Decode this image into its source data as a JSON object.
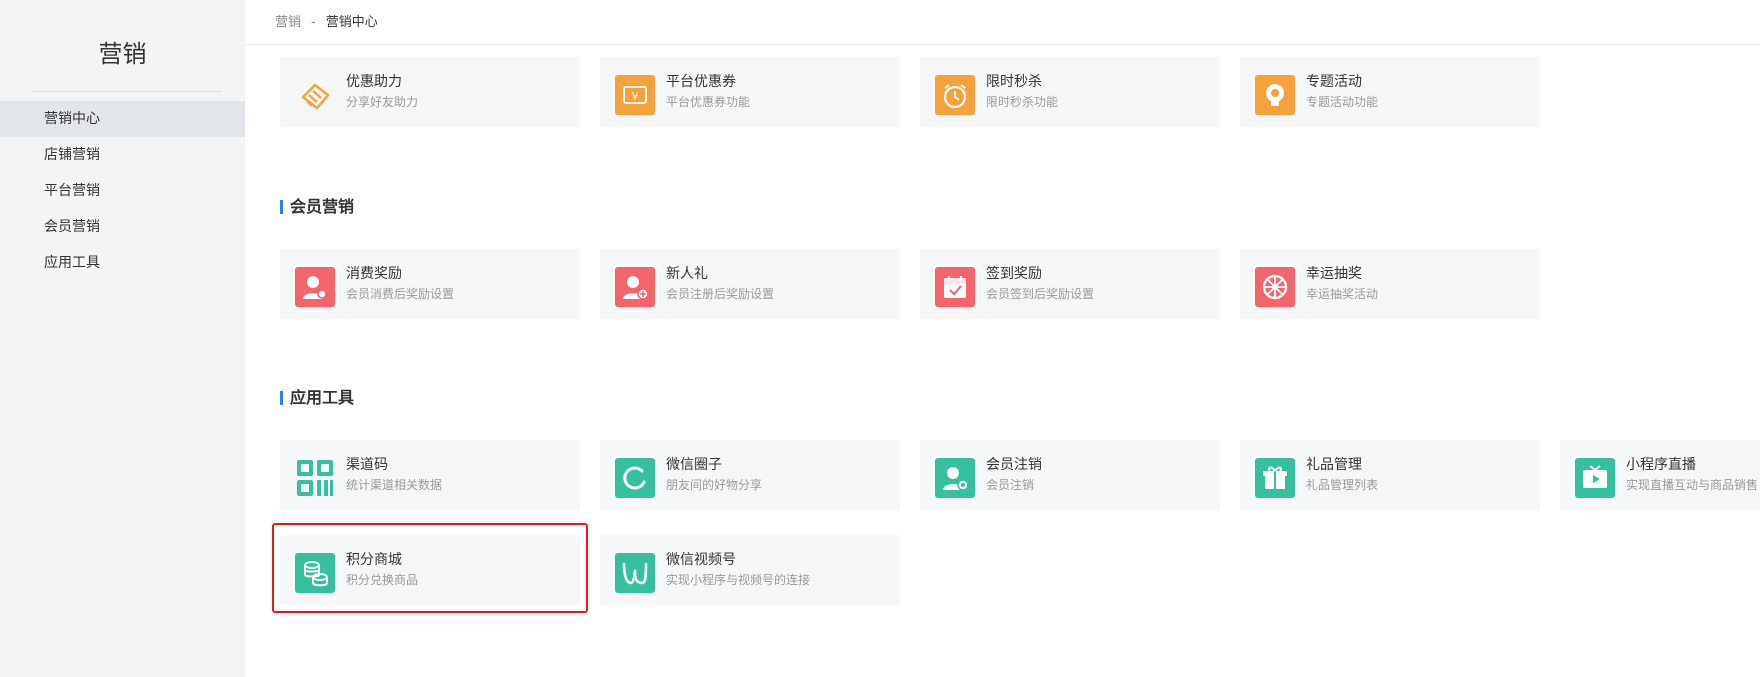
{
  "sidebar": {
    "title": "营销",
    "items": [
      {
        "label": "营销中心",
        "active": true
      },
      {
        "label": "店铺营销"
      },
      {
        "label": "平台营销"
      },
      {
        "label": "会员营销"
      },
      {
        "label": "应用工具"
      }
    ]
  },
  "breadcrumb": {
    "root": "营销",
    "separator": "-",
    "current": "营销中心"
  },
  "sections": {
    "member": {
      "title": "会员营销"
    },
    "tools": {
      "title": "应用工具"
    }
  },
  "cards": {
    "help": {
      "name": "优惠助力",
      "desc": "分享好友助力",
      "icon": "handshake-icon"
    },
    "coupon": {
      "name": "平台优惠券",
      "desc": "平台优惠券功能",
      "icon": "coupon-icon"
    },
    "flash": {
      "name": "限时秒杀",
      "desc": "限时秒杀功能",
      "icon": "alarm-clock-icon"
    },
    "topic": {
      "name": "专题活动",
      "desc": "专题活动功能",
      "icon": "bulb-icon"
    },
    "consume": {
      "name": "消费奖励",
      "desc": "会员消费后奖励设置",
      "icon": "user-reward-icon"
    },
    "newbie": {
      "name": "新人礼",
      "desc": "会员注册后奖励设置",
      "icon": "user-add-icon"
    },
    "signin": {
      "name": "签到奖励",
      "desc": "会员签到后奖励设置",
      "icon": "calendar-check-icon"
    },
    "lottery": {
      "name": "幸运抽奖",
      "desc": "幸运抽奖活动",
      "icon": "wheel-icon"
    },
    "channel": {
      "name": "渠道码",
      "desc": "统计渠道相关数据",
      "icon": "qrcode-icon"
    },
    "circle": {
      "name": "微信圈子",
      "desc": "朋友间的好物分享",
      "icon": "circle-icon"
    },
    "cancel": {
      "name": "会员注销",
      "desc": "会员注销",
      "icon": "user-cancel-icon"
    },
    "gift": {
      "name": "礼品管理",
      "desc": "礼品管理列表",
      "icon": "gift-icon"
    },
    "live": {
      "name": "小程序直播",
      "desc": "实现直播互动与商品销售",
      "icon": "tv-icon"
    },
    "points": {
      "name": "积分商城",
      "desc": "积分兑换商品",
      "icon": "coins-icon"
    },
    "channels": {
      "name": "微信视频号",
      "desc": "实现小程序与视频号的连接",
      "icon": "video-channel-icon"
    }
  },
  "colors": {
    "accent": "#2f7cf6",
    "orange": "#f7a13d",
    "red": "#f3646b",
    "green": "#35c19f",
    "highlight": "#e21b1b"
  }
}
